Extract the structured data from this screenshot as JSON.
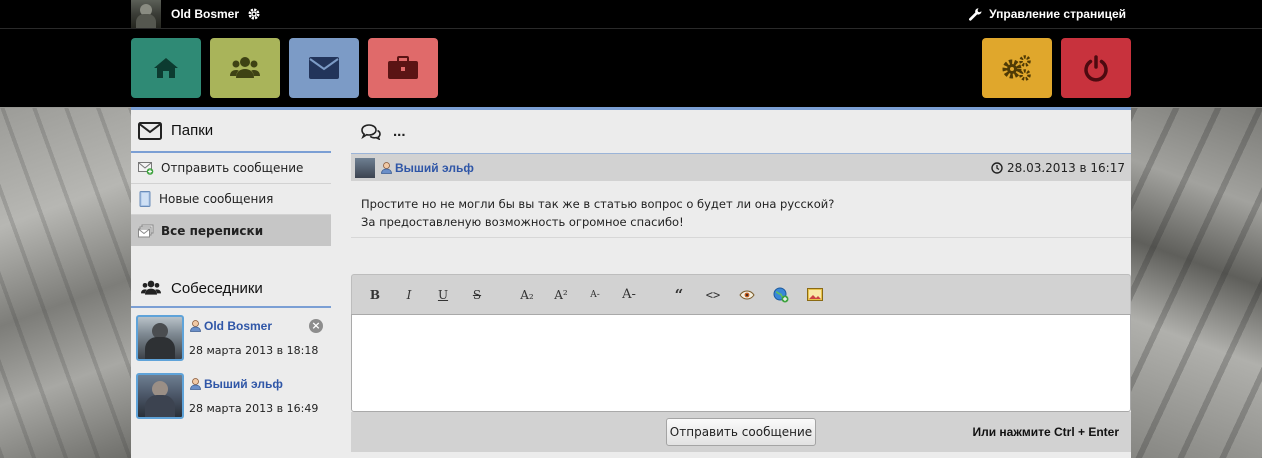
{
  "topbar": {
    "username": "Old Bosmer",
    "manage_label": "Управление страницей"
  },
  "tiles": [
    {
      "name": "home",
      "color": "#2f8a75",
      "icon": "home-icon"
    },
    {
      "name": "friends",
      "color": "#a9b45a",
      "icon": "users-icon"
    },
    {
      "name": "messages",
      "color": "#7c9bc6",
      "icon": "envelope-icon"
    },
    {
      "name": "briefcase",
      "color": "#e06a6a",
      "icon": "briefcase-icon"
    },
    {
      "name": "settings",
      "color": "#e0a72c",
      "icon": "gears-icon"
    },
    {
      "name": "logout",
      "color": "#c8323d",
      "icon": "power-icon"
    }
  ],
  "sidebar": {
    "folders_title": "Папки",
    "items": [
      {
        "label": "Отправить сообщение",
        "icon": "compose-icon"
      },
      {
        "label": "Новые сообщения",
        "icon": "new-messages-icon"
      },
      {
        "label": "Все переписки",
        "icon": "all-conversations-icon",
        "active": true
      }
    ],
    "contacts_title": "Собеседники",
    "contacts": [
      {
        "name": "Old Bosmer",
        "date": "28 марта 2013 в 18:18"
      },
      {
        "name": "Выший эльф",
        "date": "28 марта 2013 в 16:49"
      }
    ]
  },
  "conversation": {
    "title": "...",
    "message": {
      "author": "Выший эльф",
      "date": "28.03.2013 в 16:17",
      "lines": [
        "Простите но не могли бы вы так же в статью вопрос о будет ли она русской?",
        "За предоставленую возможность огромное спасибо!"
      ]
    }
  },
  "editor": {
    "toolbar": {
      "bold": "B",
      "italic": "I",
      "underline": "U",
      "strike": "S",
      "subscript": "A₂",
      "superscript": "A²",
      "smaller": "A-",
      "bigger": "A-",
      "quote": "“",
      "code": "<>"
    },
    "send_label": "Отправить сообщение",
    "hint": "Или нажмите Ctrl + Enter"
  },
  "colors": {
    "accent": "#7b9fd4",
    "link": "#2f56a7"
  }
}
